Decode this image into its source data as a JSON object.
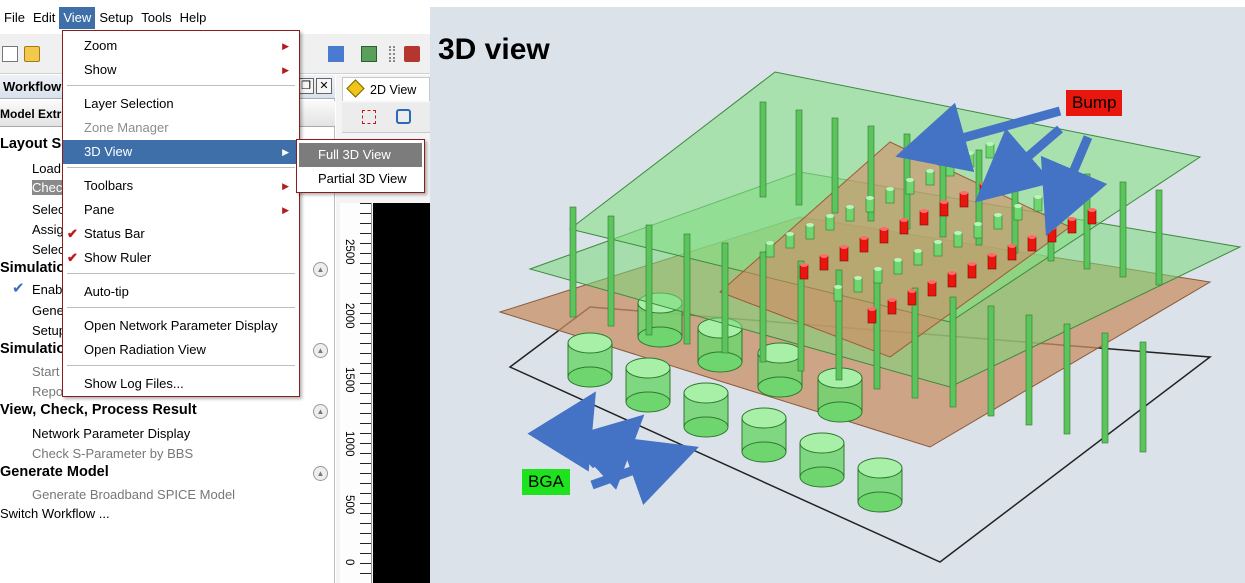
{
  "menubar": {
    "items": [
      "File",
      "Edit",
      "View",
      "Setup",
      "Tools",
      "Help"
    ],
    "active": "View"
  },
  "workflow": {
    "title": "Workflow",
    "model_tab": "Model Extr",
    "sections": [
      {
        "title": "Layout Se",
        "items": [
          "Load",
          "Chec",
          "Selec",
          "Assig",
          "Selec"
        ]
      },
      {
        "title": "Simulatio",
        "items": [
          "Enab",
          "Gene",
          "Setup"
        ]
      },
      {
        "title": "Simulatio",
        "items": [
          "Start",
          "Repo"
        ]
      },
      {
        "title": "View, Check, Process Result",
        "items": [
          "Network Parameter Display",
          "Check S-Parameter by BBS"
        ]
      },
      {
        "title": "Generate Model",
        "items": [
          "Generate Broadband SPICE Model"
        ]
      }
    ],
    "footer": "Switch Workflow ..."
  },
  "workspace": {
    "tab_label": "2D View",
    "ruler_labels": [
      "2500",
      "2000",
      "1500",
      "1000",
      "500",
      "0"
    ]
  },
  "view_menu": {
    "items": [
      {
        "label": "Zoom",
        "submenu": true
      },
      {
        "label": "Show",
        "submenu": true
      },
      {
        "label": "Layer Selection"
      },
      {
        "label": "Zone Manager",
        "disabled": true
      },
      {
        "label": "3D View",
        "submenu": true,
        "hover": true
      },
      {
        "label": "Toolbars",
        "submenu": true
      },
      {
        "label": "Pane",
        "submenu": true
      },
      {
        "label": "Status Bar",
        "checked": true
      },
      {
        "label": "Show Ruler",
        "checked": true
      },
      {
        "label": "Auto-tip"
      },
      {
        "label": "Open Network Parameter Display"
      },
      {
        "label": "Open Radiation View"
      },
      {
        "label": "Show Log Files..."
      }
    ],
    "submenu_3d": [
      "Full 3D View",
      "Partial 3D View"
    ]
  },
  "figure": {
    "title": "3D view",
    "bump_label": "Bump",
    "bga_label": "BGA"
  },
  "colors": {
    "menu_highlight": "#3f6fa8",
    "submenu_highlight": "#7c7c7c",
    "check_red": "#c0171c",
    "bump_red": "#e8160c",
    "bga_green": "#1fe21f",
    "arrow_blue": "#4472c4",
    "board_green": "#6fd66f"
  }
}
